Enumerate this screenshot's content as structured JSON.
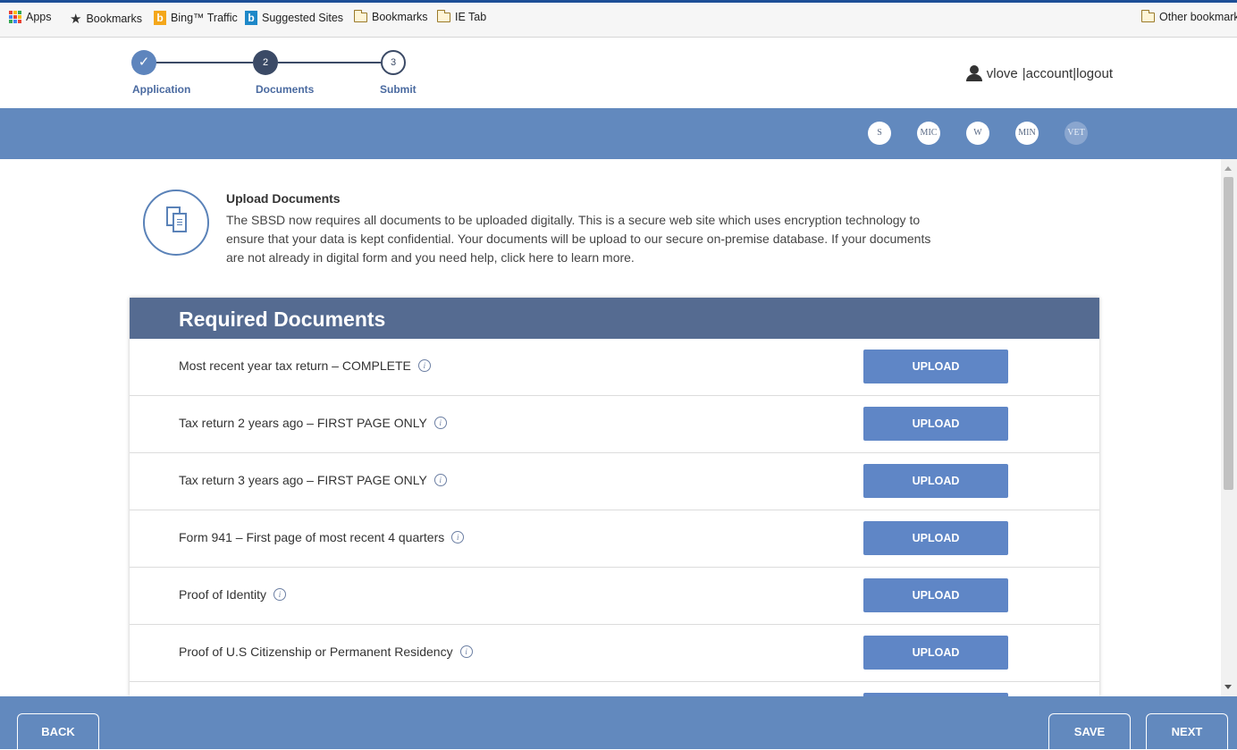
{
  "bookmarks_bar": {
    "items": [
      {
        "label": "Apps",
        "icon": "apps-grid-icon"
      },
      {
        "label": "Bookmarks",
        "icon": "star-icon"
      },
      {
        "label": "Bing™ Traffic",
        "icon": "bing-icon"
      },
      {
        "label": "Suggested Sites",
        "icon": "bing-icon"
      },
      {
        "label": "Bookmarks",
        "icon": "folder-icon"
      },
      {
        "label": "IE Tab",
        "icon": "folder-icon"
      }
    ],
    "other_bookmarks": "Other bookmarks"
  },
  "progress_steps": [
    {
      "number": "✓",
      "label": "Application",
      "state": "done"
    },
    {
      "number": "2",
      "label": "Documents",
      "state": "active"
    },
    {
      "number": "3",
      "label": "Submit",
      "state": "todo"
    }
  ],
  "user_menu": {
    "username": "vlove",
    "separator": "|",
    "account": "account",
    "logout": "logout"
  },
  "program_badges": [
    {
      "label": "S",
      "state": "active"
    },
    {
      "label": "MIC",
      "state": "active"
    },
    {
      "label": "W",
      "state": "active"
    },
    {
      "label": "MIN",
      "state": "active"
    },
    {
      "label": "VET",
      "state": "inactive"
    }
  ],
  "intro": {
    "title": "Upload Documents",
    "text": "The SBSD now requires all documents to be uploaded digitally. This is a secure web site which uses encryption technology to ensure that your data is kept confidential. Your documents will be upload to our secure on-premise database. If your documents are not already in digital form and you need help, click here to learn more."
  },
  "required_documents": {
    "heading": "Required Documents",
    "upload_label": "UPLOAD",
    "items": [
      {
        "label": "Most recent year tax return – COMPLETE"
      },
      {
        "label": "Tax return 2 years ago – FIRST PAGE ONLY"
      },
      {
        "label": "Tax return 3 years ago – FIRST PAGE ONLY"
      },
      {
        "label": "Form 941 – First page of most recent 4 quarters"
      },
      {
        "label": "Proof of Identity"
      },
      {
        "label": "Proof of U.S Citizenship or Permanent Residency"
      },
      {
        "label": ""
      }
    ]
  },
  "footer": {
    "back": "BACK",
    "save": "SAVE",
    "next": "NEXT"
  },
  "colors": {
    "brand_blue": "#6289be",
    "header_navy": "#556b91",
    "button_blue": "#5f86c6",
    "step_navy": "#3b4a66"
  }
}
